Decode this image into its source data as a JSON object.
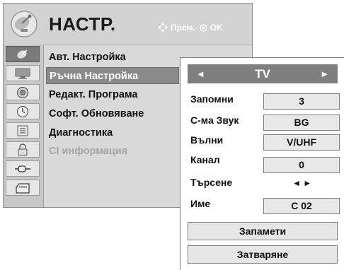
{
  "menu": {
    "title": "НАСТР.",
    "hint_move": "Прем.",
    "hint_ok": "OK",
    "items": [
      {
        "label": "Авт. Настройка"
      },
      {
        "label": "Ръчна Настройка"
      },
      {
        "label": "Редакт. Програма"
      },
      {
        "label": "Софт. Обновяване"
      },
      {
        "label": "Диагностика"
      },
      {
        "label": "CI информация"
      }
    ],
    "icons": [
      "satellite-dish-icon",
      "tv-screen-icon",
      "speaker-icon",
      "clock-icon",
      "lock-list-icon",
      "padlock-icon",
      "input-plug-icon",
      "usb-media-icon"
    ]
  },
  "panel": {
    "nav_title": "TV",
    "nav_left": "◄",
    "nav_right": "►",
    "rows": [
      {
        "label": "Запомни",
        "value": "3"
      },
      {
        "label": "С-ма Звук",
        "value": "BG"
      },
      {
        "label": "Вълни",
        "value": "V/UHF"
      },
      {
        "label": "Канал",
        "value": "0"
      },
      {
        "label": "Търсене",
        "value": "◄ ►"
      },
      {
        "label": "Име",
        "value": "C  02"
      }
    ],
    "save_label": "Запамети",
    "close_label": "Затваряне"
  },
  "colors": {
    "menu_bg": "#d9d9d9",
    "selected_bg": "#8a8a8a",
    "nav_bg": "#7f7f7f",
    "value_bg": "#e8e8e8"
  }
}
